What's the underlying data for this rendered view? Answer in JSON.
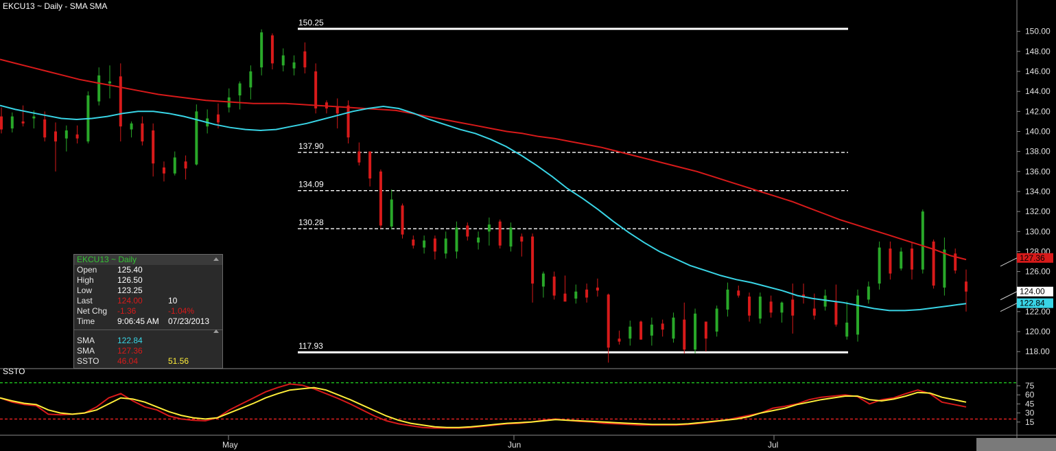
{
  "chart_data": {
    "type": "candlestick",
    "title": "EKCU13 ~ Daily  -  SMA SMA",
    "subtitle": "SSTO",
    "x_labels": [
      "May",
      "Jun",
      "Jul"
    ],
    "y_ticks": [
      "150.00",
      "148.00",
      "146.00",
      "144.00",
      "142.00",
      "140.00",
      "138.00",
      "136.00",
      "134.00",
      "132.00",
      "130.00",
      "128.00",
      "126.00",
      "124.00",
      "122.00",
      "120.00",
      "118.00"
    ],
    "ylim": [
      116.3,
      151.9
    ],
    "osc_ticks": [
      "75",
      "60",
      "45",
      "30",
      "15"
    ],
    "osc_lim": [
      0,
      100
    ],
    "osc_levels": {
      "upper": 80,
      "lower": 20
    },
    "fib_levels": [
      {
        "label": "150.25",
        "value": 150.25,
        "style": "solid"
      },
      {
        "label": "137.90",
        "value": 137.9,
        "style": "dashed"
      },
      {
        "label": "134.09",
        "value": 134.09,
        "style": "dashed"
      },
      {
        "label": "130.28",
        "value": 130.28,
        "style": "dashed"
      },
      {
        "label": "117.93",
        "value": 117.93,
        "style": "solid"
      }
    ],
    "price_tags": [
      {
        "label": "127.36",
        "value": 127.36,
        "color": "#d81a1a"
      },
      {
        "label": "124.00",
        "value": 124.0,
        "color": "#ffffff"
      },
      {
        "label": "122.84",
        "value": 122.84,
        "color": "#39d5e6"
      }
    ],
    "candles": [
      [
        141.5,
        142.4,
        139.8,
        140.2
      ],
      [
        140.3,
        141.9,
        139.9,
        141.5
      ],
      [
        141.0,
        142.6,
        140.5,
        140.8
      ],
      [
        141.3,
        142.1,
        140.3,
        141.5
      ],
      [
        141.2,
        142.0,
        139.0,
        139.4
      ],
      [
        140.0,
        140.9,
        136.0,
        139.0
      ],
      [
        139.3,
        140.6,
        138.0,
        140.1
      ],
      [
        139.7,
        140.6,
        138.8,
        139.3
      ],
      [
        139.0,
        144.0,
        138.8,
        143.6
      ],
      [
        143.0,
        146.4,
        142.6,
        145.6
      ],
      [
        144.8,
        146.6,
        143.3,
        145.0
      ],
      [
        145.5,
        146.8,
        139.0,
        140.5
      ],
      [
        140.2,
        141.0,
        139.4,
        140.8
      ],
      [
        140.8,
        141.5,
        138.6,
        139.0
      ],
      [
        140.1,
        140.8,
        135.5,
        136.8
      ],
      [
        136.4,
        137.0,
        135.0,
        135.8
      ],
      [
        135.8,
        138.0,
        135.6,
        137.4
      ],
      [
        137.0,
        137.6,
        135.2,
        136.3
      ],
      [
        136.7,
        142.7,
        136.6,
        142.0
      ],
      [
        140.5,
        142.2,
        139.8,
        141.3
      ],
      [
        141.7,
        142.8,
        140.3,
        140.9
      ],
      [
        142.4,
        144.3,
        141.9,
        143.4
      ],
      [
        143.6,
        145.0,
        142.2,
        144.8
      ],
      [
        144.4,
        146.6,
        143.2,
        146.0
      ],
      [
        146.4,
        150.2,
        145.6,
        149.9
      ],
      [
        149.6,
        149.8,
        146.2,
        146.8
      ],
      [
        146.6,
        148.3,
        146.0,
        147.6
      ],
      [
        146.3,
        147.6,
        145.6,
        146.9
      ],
      [
        148.0,
        148.9,
        145.8,
        146.4
      ],
      [
        146.0,
        146.8,
        141.8,
        142.3
      ],
      [
        142.9,
        143.1,
        141.8,
        142.3
      ],
      [
        142.4,
        143.3,
        140.3,
        141.8
      ],
      [
        142.6,
        143.1,
        138.8,
        139.4
      ],
      [
        138.0,
        138.9,
        136.6,
        136.9
      ],
      [
        138.0,
        138.0,
        134.5,
        135.3
      ],
      [
        136.0,
        136.2,
        130.3,
        130.6
      ],
      [
        130.5,
        134.2,
        130.2,
        133.2
      ],
      [
        132.6,
        132.8,
        129.3,
        129.7
      ],
      [
        129.2,
        129.6,
        128.3,
        128.6
      ],
      [
        128.4,
        129.6,
        127.8,
        129.1
      ],
      [
        129.3,
        129.6,
        127.2,
        128.0
      ],
      [
        127.8,
        130.0,
        127.3,
        129.3
      ],
      [
        128.0,
        131.0,
        127.3,
        130.4
      ],
      [
        130.6,
        130.9,
        129.1,
        129.5
      ],
      [
        128.9,
        130.0,
        128.2,
        129.4
      ],
      [
        130.0,
        131.4,
        128.6,
        130.7
      ],
      [
        131.0,
        131.2,
        128.3,
        128.6
      ],
      [
        128.5,
        130.9,
        128.0,
        130.4
      ],
      [
        129.5,
        129.8,
        127.5,
        129.0
      ],
      [
        129.5,
        129.8,
        122.9,
        124.8
      ],
      [
        124.5,
        126.0,
        123.4,
        125.8
      ],
      [
        125.5,
        126.0,
        123.2,
        123.6
      ],
      [
        123.8,
        125.6,
        123.0,
        123.0
      ],
      [
        123.3,
        124.7,
        122.8,
        124.0
      ],
      [
        124.2,
        124.8,
        122.9,
        123.4
      ],
      [
        124.4,
        125.3,
        123.5,
        124.1
      ],
      [
        123.7,
        123.8,
        116.9,
        118.4
      ],
      [
        119.3,
        120.1,
        118.7,
        119.0
      ],
      [
        119.3,
        121.1,
        118.6,
        120.5
      ],
      [
        121.0,
        121.1,
        119.2,
        119.2
      ],
      [
        119.6,
        121.4,
        118.6,
        120.7
      ],
      [
        120.8,
        121.2,
        119.5,
        120.2
      ],
      [
        119.3,
        121.9,
        118.9,
        121.4
      ],
      [
        121.2,
        122.9,
        117.8,
        118.2
      ],
      [
        118.2,
        122.3,
        117.8,
        121.8
      ],
      [
        121.0,
        121.0,
        118.0,
        119.3
      ],
      [
        120.0,
        122.6,
        119.5,
        122.3
      ],
      [
        122.2,
        124.9,
        121.5,
        124.2
      ],
      [
        124.1,
        124.6,
        123.4,
        123.6
      ],
      [
        123.5,
        123.9,
        121.0,
        121.6
      ],
      [
        121.3,
        123.9,
        120.8,
        123.5
      ],
      [
        123.0,
        123.6,
        121.4,
        121.9
      ],
      [
        121.9,
        123.0,
        120.9,
        122.9
      ],
      [
        123.2,
        124.8,
        119.8,
        121.6
      ],
      [
        123.7,
        124.8,
        122.8,
        123.4
      ],
      [
        122.3,
        123.8,
        121.2,
        121.6
      ],
      [
        122.5,
        124.2,
        122.1,
        123.6
      ],
      [
        123.0,
        124.7,
        120.5,
        120.7
      ],
      [
        119.5,
        123.0,
        119.2,
        120.9
      ],
      [
        119.7,
        124.2,
        119.0,
        123.6
      ],
      [
        123.2,
        125.0,
        122.8,
        124.5
      ],
      [
        124.8,
        129.0,
        124.2,
        128.4
      ],
      [
        128.3,
        129.0,
        125.2,
        125.8
      ],
      [
        126.3,
        128.4,
        126.1,
        128.0
      ],
      [
        128.3,
        128.9,
        125.2,
        126.2
      ],
      [
        126.2,
        132.2,
        125.8,
        132.0
      ],
      [
        129.0,
        129.2,
        124.3,
        124.6
      ],
      [
        124.4,
        129.4,
        123.6,
        128.2
      ],
      [
        127.8,
        128.3,
        125.8,
        126.1
      ],
      [
        125.0,
        126.2,
        122.0,
        124.0
      ]
    ],
    "series": [
      {
        "name": "SMA",
        "color": "#d81a1a",
        "values": [
          147.2,
          146.8,
          146.4,
          146.0,
          145.6,
          145.2,
          144.9,
          144.6,
          144.3,
          144.0,
          143.7,
          143.5,
          143.3,
          143.1,
          143.0,
          142.9,
          142.8,
          142.8,
          142.8,
          142.7,
          142.6,
          142.5,
          142.4,
          142.3,
          142.2,
          142.1,
          141.8,
          141.5,
          141.2,
          140.9,
          140.6,
          140.3,
          140.0,
          139.8,
          139.5,
          139.3,
          139.0,
          138.7,
          138.4,
          138.0,
          137.6,
          137.2,
          136.8,
          136.4,
          136.0,
          135.5,
          135.0,
          134.5,
          134.0,
          133.5,
          133.0,
          132.4,
          131.8,
          131.2,
          130.7,
          130.2,
          129.7,
          129.2,
          128.7,
          128.2,
          127.6,
          127.2
        ]
      },
      {
        "name": "SMA",
        "color": "#39d5e6",
        "values": [
          142.6,
          142.2,
          141.9,
          141.6,
          141.3,
          141.2,
          141.3,
          141.5,
          141.8,
          142.0,
          142.0,
          141.8,
          141.5,
          141.1,
          140.7,
          140.4,
          140.2,
          140.1,
          140.2,
          140.5,
          140.8,
          141.2,
          141.6,
          142.0,
          142.3,
          142.5,
          142.3,
          141.8,
          141.2,
          140.7,
          140.2,
          139.8,
          139.2,
          138.5,
          137.6,
          136.6,
          135.5,
          134.3,
          133.3,
          132.2,
          131.0,
          129.9,
          128.9,
          128.0,
          127.3,
          126.6,
          126.1,
          125.6,
          125.2,
          124.9,
          124.5,
          124.1,
          123.6,
          123.3,
          123.1,
          122.9,
          122.6,
          122.3,
          122.1,
          122.1,
          122.2,
          122.4,
          122.6,
          122.8
        ]
      }
    ],
    "oscillator": [
      {
        "name": "SSTO",
        "color": "#d81a1a",
        "values": [
          55,
          48,
          44,
          42,
          28,
          27,
          28,
          30,
          40,
          55,
          62,
          50,
          40,
          35,
          25,
          20,
          18,
          17,
          22,
          35,
          45,
          55,
          65,
          72,
          78,
          76,
          70,
          62,
          54,
          45,
          35,
          25,
          17,
          12,
          9,
          6,
          5,
          5,
          5,
          6,
          8,
          10,
          12,
          13,
          15,
          18,
          20,
          18,
          16,
          15,
          13,
          12,
          11,
          10,
          10,
          10,
          10,
          11,
          13,
          15,
          18,
          22,
          26,
          30,
          38,
          41,
          45,
          52,
          56,
          58,
          60,
          57,
          45,
          52,
          55,
          62,
          68,
          62,
          48,
          44,
          40
        ]
      },
      {
        "name": "SSTO",
        "color": "#ffee3a",
        "values": [
          55,
          50,
          46,
          44,
          35,
          30,
          28,
          30,
          35,
          45,
          55,
          53,
          48,
          40,
          32,
          26,
          22,
          20,
          22,
          30,
          38,
          46,
          55,
          62,
          68,
          70,
          72,
          68,
          60,
          52,
          43,
          34,
          25,
          18,
          13,
          10,
          7,
          6,
          6,
          7,
          9,
          11,
          13,
          14,
          15,
          17,
          19,
          18,
          17,
          16,
          15,
          14,
          13,
          12,
          11,
          11,
          11,
          12,
          14,
          16,
          18,
          20,
          24,
          30,
          34,
          38,
          44,
          48,
          52,
          55,
          58,
          58,
          52,
          50,
          53,
          58,
          64,
          63,
          56,
          52,
          48
        ]
      }
    ]
  },
  "panel": {
    "title": "EKCU13 ~ Daily",
    "rows": [
      {
        "label": "Open",
        "value": "125.40"
      },
      {
        "label": "High",
        "value": "126.50"
      },
      {
        "label": "Low",
        "value": "123.25"
      },
      {
        "label": "Last",
        "value": "124.00",
        "value2": "10"
      },
      {
        "label": "Net Chg",
        "value": "-1.36",
        "value2": "-1.04%"
      },
      {
        "label": "Time",
        "value": "9:06:45 AM",
        "value2": "07/23/2013"
      }
    ],
    "indicators": [
      {
        "label": "SMA",
        "value": "122.84"
      },
      {
        "label": "SMA",
        "value": "127.36"
      },
      {
        "label": "SSTO",
        "value": "46.04",
        "value2": "51.56"
      }
    ]
  },
  "colors": {
    "up": "#29a829",
    "down": "#d81a1a",
    "sma_fast": "#39d5e6",
    "sma_slow": "#d81a1a",
    "osc_k": "#d81a1a",
    "osc_d": "#ffee3a",
    "level_upper": "#22cc22",
    "level_lower": "#ee2222"
  }
}
